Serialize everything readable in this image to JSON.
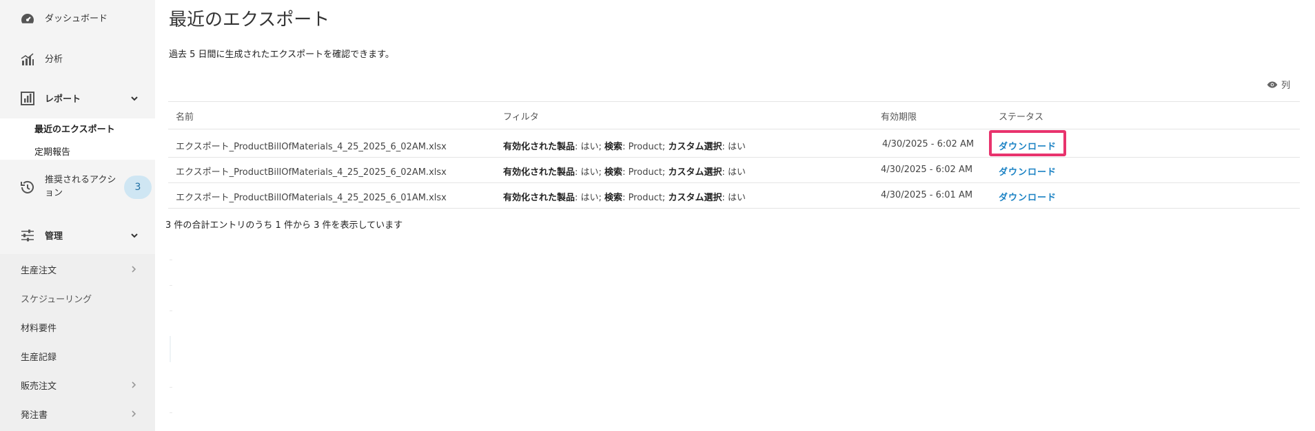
{
  "sidebar": {
    "dashboard": "ダッシュボード",
    "analytics": "分析",
    "reports": "レポート",
    "reports_sub": [
      "最近のエクスポート",
      "定期報告"
    ],
    "recommended": "推奨されるアクション",
    "recommended_line1": "推奨されるアクシ",
    "recommended_line2": "ョン",
    "recommended_count": "3",
    "management": "管理",
    "management_sub": [
      "生産注文",
      "スケジューリング",
      "材料要件",
      "生産記録",
      "販売注文",
      "発注書"
    ]
  },
  "main": {
    "title": "最近のエクスポート",
    "description": "過去 5 日間に生成されたエクスポートを確認できます。",
    "columns_label": "列",
    "headers": [
      "名前",
      "フィルタ",
      "有効期限",
      "ステータス"
    ],
    "rows": [
      {
        "name": "エクスポート_ProductBillOfMaterials_4_25_2025_6_02AM.xlsx",
        "f1k": "有効化された製品",
        "f1v": ": はい; ",
        "f2k": "検索",
        "f2v": ": Product; ",
        "f3k": "カスタム選択",
        "f3v": ": はい",
        "expiry": "4/30/2025 - 6:02 AM",
        "status": "ダウンロード"
      },
      {
        "name": "エクスポート_ProductBillOfMaterials_4_25_2025_6_02AM.xlsx",
        "f1k": "有効化された製品",
        "f1v": ": はい; ",
        "f2k": "検索",
        "f2v": ": Product; ",
        "f3k": "カスタム選択",
        "f3v": ": はい",
        "expiry": "4/30/2025 - 6:02 AM",
        "status": "ダウンロード"
      },
      {
        "name": "エクスポート_ProductBillOfMaterials_4_25_2025_6_01AM.xlsx",
        "f1k": "有効化された製品",
        "f1v": ": はい; ",
        "f2k": "検索",
        "f2v": ": Product; ",
        "f3k": "カスタム選択",
        "f3v": ": はい",
        "expiry": "4/30/2025 - 6:01 AM",
        "status": "ダウンロード"
      }
    ],
    "entries_info": "3 件の合計エントリのうち 1 件から 3 件を表示しています"
  },
  "colors": {
    "accent": "#1b82c4",
    "highlight": "#e8336d",
    "badge_bg": "#cfe6f3"
  },
  "icons": [
    "speedometer-icon",
    "bar-chart-icon",
    "report-icon",
    "history-icon",
    "sliders-icon",
    "chevron-down-icon",
    "chevron-right-icon",
    "eye-icon"
  ]
}
